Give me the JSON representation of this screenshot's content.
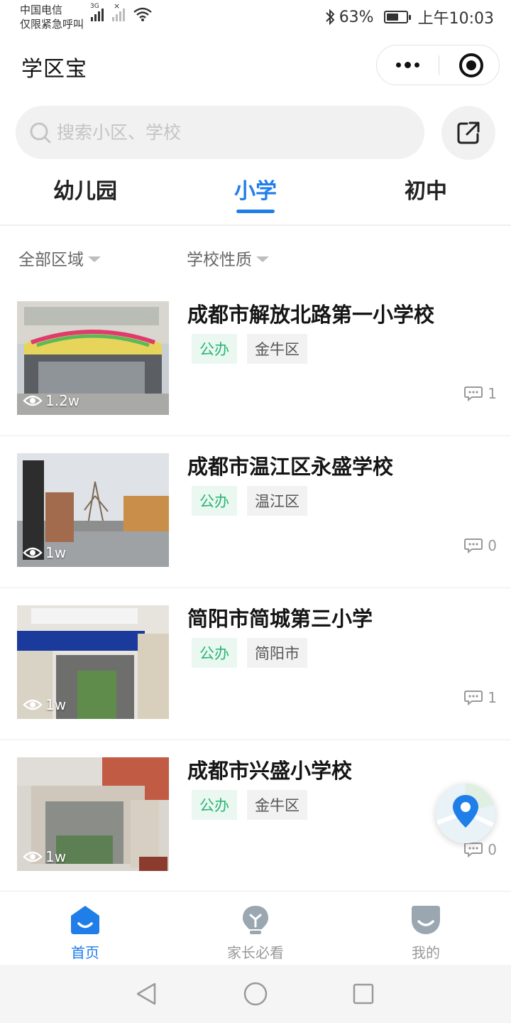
{
  "status_bar": {
    "carrier_line1": "中国电信",
    "carrier_line2": "仅限紧急呼叫",
    "network_tag": "3G",
    "battery": "63%",
    "battery_level": 0.63,
    "time": "上午10:03"
  },
  "header": {
    "title": "学区宝"
  },
  "search": {
    "placeholder": "搜索小区、学校",
    "value": ""
  },
  "tabs": [
    {
      "label": "幼儿园",
      "active": false
    },
    {
      "label": "小学",
      "active": true
    },
    {
      "label": "初中",
      "active": false
    }
  ],
  "filters": {
    "region": "全部区域",
    "type": "学校性质"
  },
  "schools": [
    {
      "name": "成都市解放北路第一小学校",
      "tag1": "公办",
      "tag2": "金牛区",
      "views": "1.2w",
      "comments": "1"
    },
    {
      "name": "成都市温江区永盛学校",
      "tag1": "公办",
      "tag2": "温江区",
      "views": "1w",
      "comments": "0"
    },
    {
      "name": "简阳市简城第三小学",
      "tag1": "公办",
      "tag2": "简阳市",
      "views": "1w",
      "comments": "1"
    },
    {
      "name": "成都市兴盛小学校",
      "tag1": "公办",
      "tag2": "金牛区",
      "views": "1w",
      "comments": "0"
    }
  ],
  "bottom_nav": [
    {
      "label": "首页",
      "icon": "home-icon",
      "active": true
    },
    {
      "label": "家长必看",
      "icon": "bulb-icon",
      "active": false
    },
    {
      "label": "我的",
      "icon": "profile-icon",
      "active": false
    }
  ],
  "colors": {
    "accent": "#1f7ee8",
    "tag_green": "#2bb673",
    "tag_green_bg": "#eaf8f1"
  }
}
